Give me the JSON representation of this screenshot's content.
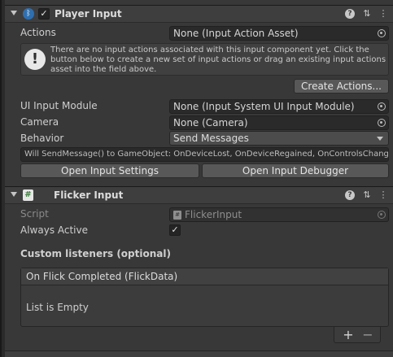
{
  "player_input": {
    "title": "Player Input",
    "enabled": true,
    "actions": {
      "label": "Actions",
      "value": "None (Input Action Asset)"
    },
    "help_text": "There are no input actions associated with this input component yet. Click the button below to create a new set of input actions or drag an existing input actions asset into the field above.",
    "create_actions": "Create Actions...",
    "ui_input_module": {
      "label": "UI Input Module",
      "value": "None (Input System UI Input Module)"
    },
    "camera": {
      "label": "Camera",
      "value": "None (Camera)"
    },
    "behavior": {
      "label": "Behavior",
      "value": "Send Messages"
    },
    "behavior_info": "Will SendMessage() to GameObject: OnDeviceLost, OnDeviceRegained, OnControlsChanged",
    "open_settings": "Open Input Settings",
    "open_debugger": "Open Input Debugger"
  },
  "flicker_input": {
    "title": "Flicker Input",
    "script": {
      "label": "Script",
      "value": "FlickerInput"
    },
    "always_active": {
      "label": "Always Active",
      "checked": true
    },
    "custom_listeners": "Custom listeners (optional)",
    "event_name": "On Flick Completed (FlickData)",
    "list_empty": "List is Empty",
    "add": "+",
    "remove": "−"
  },
  "icons": {
    "help": "?",
    "presets": "⇅",
    "menu": "⋮",
    "check": "✓",
    "warning": "!",
    "script": "#"
  }
}
